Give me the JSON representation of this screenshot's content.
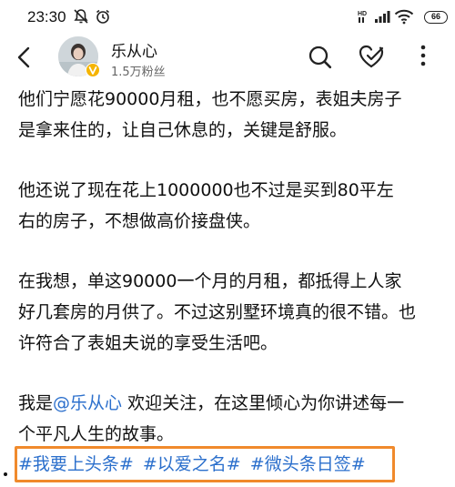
{
  "status_bar": {
    "time": "23:30",
    "battery": "66",
    "network_label": "HD"
  },
  "header": {
    "user_name": "乐从心",
    "fans": "1.5万粉丝",
    "icons": [
      "back-arrow-icon",
      "search-icon",
      "heart-check-icon",
      "more-icon"
    ]
  },
  "article": {
    "paragraphs": [
      [
        "他们宁愿花90000月租，也不愿买房，表姐夫房子",
        "是拿来住的，让自己休息的，关键是舒服。"
      ],
      [
        "他还说了现在花上1000000也不过是买到80平左",
        "右的房子，不想做高价接盘侠。"
      ],
      [
        "在我想，单这90000一个月的月租，都抵得上人家",
        "好几套房的月供了。不过这别墅环境真的很不错。也",
        "许符合了表姐夫说的享受生活吧。"
      ]
    ],
    "closing": {
      "prefix": "我是",
      "mention": "@乐从心",
      "line1_rest": " 欢迎关注，在这里倾心为你讲述每一",
      "line2": "个平凡人生的故事。"
    }
  },
  "tags": [
    "#我要上头条#",
    "#以爱之名#",
    "#微头条日签#"
  ],
  "colors": {
    "link": "#2b6fcc",
    "highlight_box": "#f08a2c"
  }
}
